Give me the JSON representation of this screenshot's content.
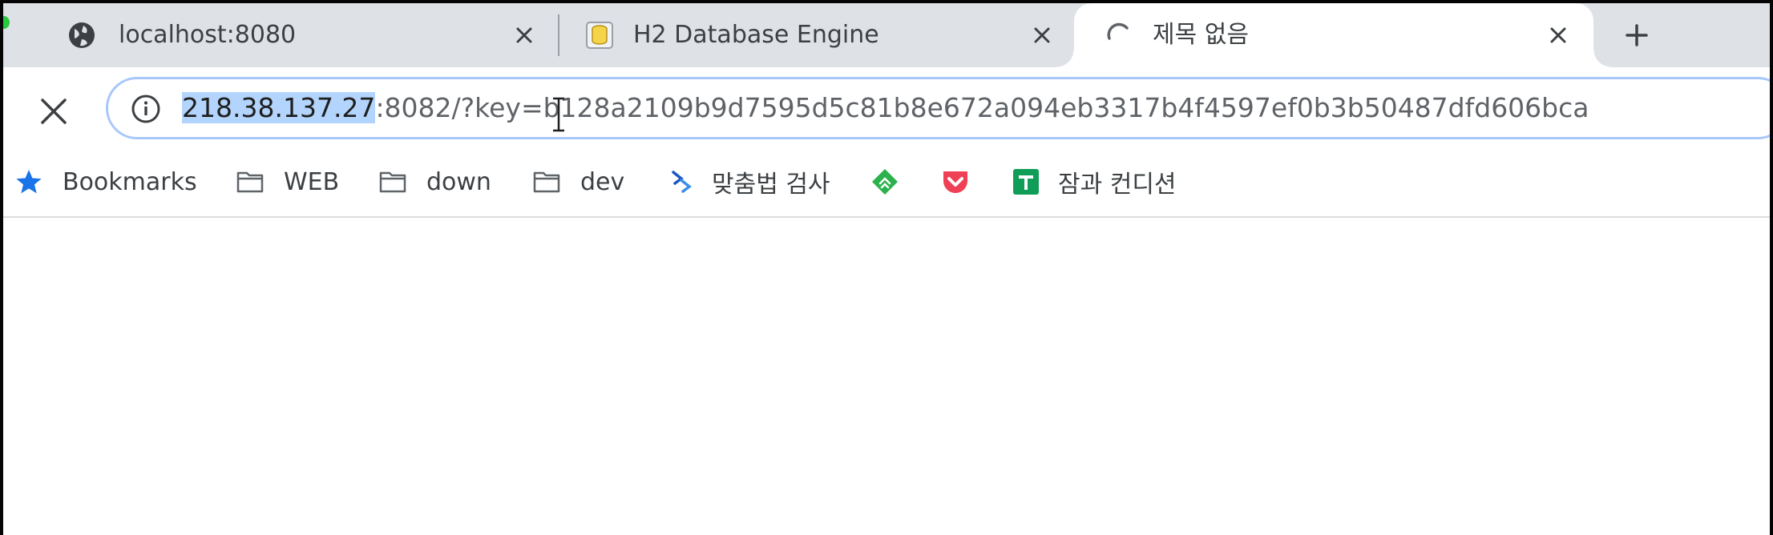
{
  "tabs": [
    {
      "title": "localhost:8080",
      "icon": "globe-icon",
      "active": false
    },
    {
      "title": "H2 Database Engine",
      "icon": "h2-database-icon",
      "active": false
    },
    {
      "title": "제목 없음",
      "icon": "loading-spinner-icon",
      "active": true
    }
  ],
  "toolbar": {
    "stop_icon": "close-icon",
    "url_host": "218.38.137.27",
    "url_rest": ":8082/?key=b128a2109b9d7595d5c81b8e672a094eb3317b4f4597ef0b3b50487dfd606bca",
    "info_icon": "info-icon"
  },
  "bookmarks": [
    {
      "label": "Bookmarks",
      "icon": "star-icon"
    },
    {
      "label": "WEB",
      "icon": "folder-icon"
    },
    {
      "label": "down",
      "icon": "folder-icon"
    },
    {
      "label": "dev",
      "icon": "folder-icon"
    },
    {
      "label": "맞춤법 검사",
      "icon": "spell-check-icon"
    },
    {
      "label": "",
      "icon": "feedly-icon"
    },
    {
      "label": "",
      "icon": "pocket-icon"
    },
    {
      "label": "잠과 컨디션",
      "icon": "google-sheets-icon"
    }
  ],
  "colors": {
    "tabstrip_bg": "#dee1e6",
    "omnibox_border": "#a8c7fa",
    "selection": "#b3d4fc",
    "star": "#1a73e8",
    "feedly": "#2bb24c",
    "pocket": "#ef4056",
    "sheets": "#0f9d58"
  }
}
